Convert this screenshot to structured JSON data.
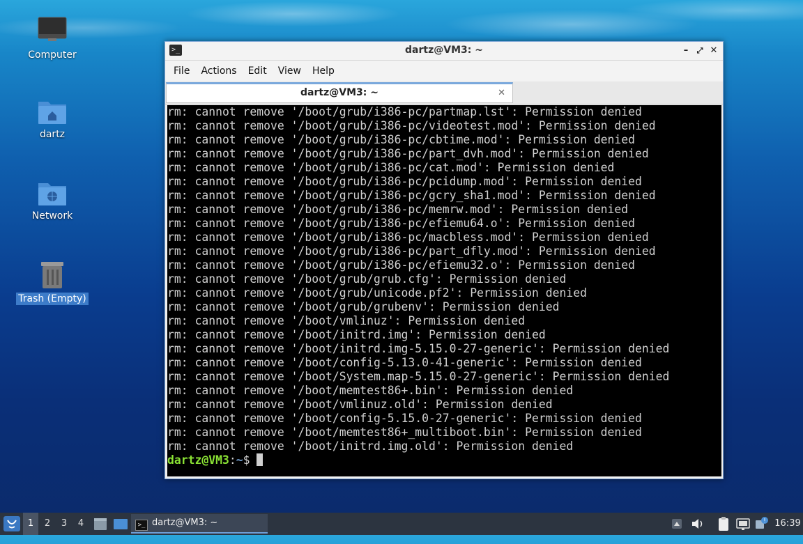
{
  "desktop": {
    "icons": [
      {
        "label": "Computer"
      },
      {
        "label": "dartz"
      },
      {
        "label": "Network"
      },
      {
        "label": "Trash (Empty)"
      }
    ]
  },
  "window": {
    "title": "dartz@VM3: ~",
    "menu": [
      "File",
      "Actions",
      "Edit",
      "View",
      "Help"
    ],
    "tab_label": "dartz@VM3: ~",
    "controls": {
      "minimize": "–",
      "maximize": "⤢",
      "close": "✕"
    }
  },
  "terminal": {
    "lines": [
      "rm: cannot remove '/boot/grub/i386-pc/partmap.lst': Permission denied",
      "rm: cannot remove '/boot/grub/i386-pc/videotest.mod': Permission denied",
      "rm: cannot remove '/boot/grub/i386-pc/cbtime.mod': Permission denied",
      "rm: cannot remove '/boot/grub/i386-pc/part_dvh.mod': Permission denied",
      "rm: cannot remove '/boot/grub/i386-pc/cat.mod': Permission denied",
      "rm: cannot remove '/boot/grub/i386-pc/pcidump.mod': Permission denied",
      "rm: cannot remove '/boot/grub/i386-pc/gcry_sha1.mod': Permission denied",
      "rm: cannot remove '/boot/grub/i386-pc/memrw.mod': Permission denied",
      "rm: cannot remove '/boot/grub/i386-pc/efiemu64.o': Permission denied",
      "rm: cannot remove '/boot/grub/i386-pc/macbless.mod': Permission denied",
      "rm: cannot remove '/boot/grub/i386-pc/part_dfly.mod': Permission denied",
      "rm: cannot remove '/boot/grub/i386-pc/efiemu32.o': Permission denied",
      "rm: cannot remove '/boot/grub/grub.cfg': Permission denied",
      "rm: cannot remove '/boot/grub/unicode.pf2': Permission denied",
      "rm: cannot remove '/boot/grub/grubenv': Permission denied",
      "rm: cannot remove '/boot/vmlinuz': Permission denied",
      "rm: cannot remove '/boot/initrd.img': Permission denied",
      "rm: cannot remove '/boot/initrd.img-5.15.0-27-generic': Permission denied",
      "rm: cannot remove '/boot/config-5.13.0-41-generic': Permission denied",
      "rm: cannot remove '/boot/System.map-5.15.0-27-generic': Permission denied",
      "rm: cannot remove '/boot/memtest86+.bin': Permission denied",
      "rm: cannot remove '/boot/vmlinuz.old': Permission denied",
      "rm: cannot remove '/boot/config-5.15.0-27-generic': Permission denied",
      "rm: cannot remove '/boot/memtest86+_multiboot.bin': Permission denied",
      "rm: cannot remove '/boot/initrd.img.old': Permission denied"
    ],
    "prompt": {
      "user_host": "dartz@VM3",
      "sep": ":",
      "path": "~",
      "symbol": "$ "
    }
  },
  "taskbar": {
    "workspaces": [
      "1",
      "2",
      "3",
      "4"
    ],
    "active_task": "dartz@VM3: ~",
    "clock": "16:39",
    "tray_icons": [
      "up-arrow-icon",
      "volume-icon",
      "clipboard-icon",
      "network-icon",
      "notification-icon"
    ]
  },
  "colors": {
    "prompt_user": "#8ae234",
    "prompt_path": "#729fcf",
    "terminal_bg": "#000000",
    "taskbar_bg": "#2c3440",
    "accent": "#6f9fd8"
  }
}
